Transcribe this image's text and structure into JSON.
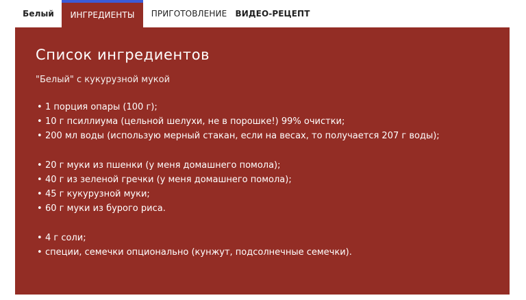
{
  "tabs": [
    {
      "label": "Белый"
    },
    {
      "label": "ИНГРЕДИЕНТЫ"
    },
    {
      "label": "ПРИГОТОВЛЕНИЕ"
    },
    {
      "label": "ВИДЕО-РЕЦЕПТ"
    }
  ],
  "active_tab": "ИНГРЕДИЕНТЫ",
  "panel": {
    "title": "Список ингредиентов",
    "subtitle": "\"Белый\" с кукурузной мукой",
    "groups": [
      {
        "items": [
          "1 порция опары (100 г);",
          "10 г псиллиума (цельной шелухи, не в порошке!) 99% очистки;",
          "200 мл воды (использую мерный стакан, если на весах, то получается 207 г воды);"
        ]
      },
      {
        "items": [
          "20 г муки из пшенки (у меня домашнего помола);",
          "40 г из зеленой гречки (у меня домашнего помола);",
          "45 г кукурузной муки;",
          "60 г муки из бурого риса."
        ]
      },
      {
        "items": [
          "4 г соли;",
          "специи, семечки опционально (кунжут, подсолнечные семечки)."
        ]
      }
    ]
  },
  "colors": {
    "panel_background": "#932d25",
    "active_tab_border": "#3b5bd9",
    "text_light": "#ffffff",
    "tab_text": "#1f1f1f"
  }
}
